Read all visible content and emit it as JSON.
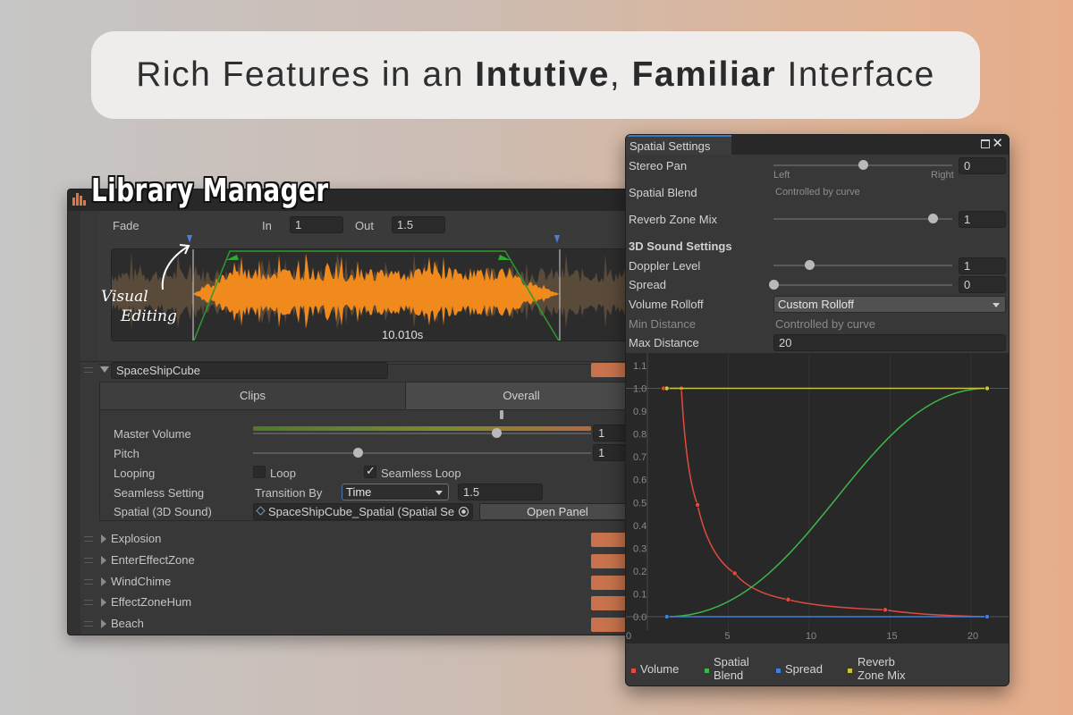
{
  "banner": {
    "pre": "Rich Features in an ",
    "b1": "Intutive",
    "mid": ", ",
    "b2": "Familiar",
    "post": " Interface"
  },
  "library": {
    "title": "Library Manager",
    "fade": {
      "label": "Fade",
      "in_label": "In",
      "in_value": "1",
      "out_label": "Out",
      "out_value": "1.5"
    },
    "waveform": {
      "duration": "10.010s"
    },
    "annotation": {
      "line1": "Visual",
      "line2": "Editing"
    },
    "expanded_item": {
      "name": "SpaceShipCube",
      "tabs": [
        "Clips",
        "Overall"
      ],
      "master_volume": {
        "label": "Master Volume",
        "value": "1",
        "level": 0.72
      },
      "pitch": {
        "label": "Pitch",
        "value": "1",
        "level": 0.31
      },
      "looping": {
        "label": "Looping",
        "loop_label": "Loop",
        "loop_checked": false,
        "seamless_label": "Seamless Loop",
        "seamless_checked": true
      },
      "seamless_setting": {
        "label": "Seamless Setting",
        "transition_label": "Transition By",
        "transition_value": "Time",
        "value": "1.5"
      },
      "spatial": {
        "label": "Spatial (3D Sound)",
        "value": "SpaceShipCube_Spatial (Spatial Se",
        "button": "Open Panel"
      }
    },
    "items": [
      "Explosion",
      "EnterEffectZone",
      "WindChime",
      "EffectZoneHum",
      "Beach"
    ],
    "accent_color": "#c8734e"
  },
  "spatial": {
    "tab": "Spatial Settings",
    "stereo_pan": {
      "label": "Stereo Pan",
      "value": "0",
      "left": "Left",
      "right": "Right",
      "level": 0.5
    },
    "spatial_blend": {
      "label": "Spatial Blend",
      "note": "Controlled by curve"
    },
    "reverb": {
      "label": "Reverb Zone Mix",
      "value": "1",
      "level": 0.89
    },
    "section": "3D Sound Settings",
    "doppler": {
      "label": "Doppler Level",
      "value": "1",
      "level": 0.2
    },
    "spread": {
      "label": "Spread",
      "value": "0",
      "level": 0.0
    },
    "rolloff": {
      "label": "Volume Rolloff",
      "value": "Custom Rolloff"
    },
    "min_distance": {
      "label": "Min Distance",
      "note": "Controlled by curve"
    },
    "max_distance": {
      "label": "Max Distance",
      "value": "20"
    },
    "legend": [
      {
        "name": "Volume",
        "color": "#e04a3f"
      },
      {
        "name": "Spatial Blend",
        "line1": "Spatial",
        "line2": "Blend",
        "color": "#3fb54a"
      },
      {
        "name": "Spread",
        "color": "#3e7fdc"
      },
      {
        "name": "Reverb Zone Mix",
        "line1": "Reverb",
        "line2": "Zone Mix",
        "color": "#c9c23a"
      }
    ]
  },
  "chart_data": {
    "type": "line",
    "xlim": [
      0,
      21
    ],
    "ylim": [
      0,
      1.1
    ],
    "x_ticks": [
      "5",
      "10",
      "15",
      "20"
    ],
    "y_ticks": [
      "0.0",
      "0.1",
      "0.2",
      "0.3",
      "0.4",
      "0.5",
      "0.6",
      "0.7",
      "0.8",
      "0.9",
      "1.0",
      "1.1"
    ],
    "series": [
      {
        "name": "Volume",
        "color": "#e04a3f",
        "points": [
          [
            1,
            1.0
          ],
          [
            2.1,
            1.0
          ],
          [
            3.1,
            0.49
          ],
          [
            5.4,
            0.19
          ],
          [
            8.7,
            0.075
          ],
          [
            14.7,
            0.03
          ],
          [
            21,
            0.0
          ]
        ]
      },
      {
        "name": "Spatial Blend",
        "color": "#3fb54a",
        "points": [
          [
            1.2,
            0.0
          ],
          [
            21,
            1.0
          ]
        ]
      },
      {
        "name": "Spread",
        "color": "#3e7fdc",
        "points": [
          [
            1.2,
            0.0
          ],
          [
            21,
            0.0
          ]
        ]
      },
      {
        "name": "Reverb Zone Mix",
        "color": "#c9c23a",
        "points": [
          [
            1.2,
            1.0
          ],
          [
            21,
            1.0
          ]
        ]
      }
    ]
  }
}
